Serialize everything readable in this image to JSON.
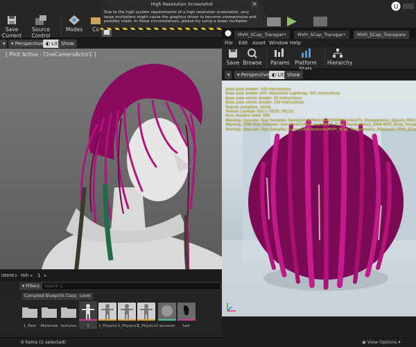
{
  "main_toolbar": {
    "save_current": "Save Current",
    "source_control": "Source Control",
    "modes": "Modes",
    "content_partial": "Co"
  },
  "screenshot_dialog": {
    "title": "High Resolution Screenshot",
    "message": "Due to the high system requirements of a high resolution screenshot, very large multipliers might cause the graphics driver to become unresponsive and possibly crash. In these circumstances, please try using a lower multiplier"
  },
  "left_viewport": {
    "perspective": "Perspective",
    "lit": "Lit",
    "show": "Show",
    "pilot_label": "[ Pilot Active - CineCameraActor1 ]"
  },
  "material_editor": {
    "tabs": [
      "MVH_SCap_Transpar•",
      "MVH_SCap_Transpar•",
      "MVH_SCap_Transpare"
    ],
    "menu": [
      "File",
      "Edit",
      "Asset",
      "Window",
      "Help"
    ],
    "toolbar": {
      "save": "Save",
      "browse": "Browse",
      "params": "Params",
      "platform_stats": "Platform Stats",
      "hierarchy": "Hierarchy"
    },
    "viewport": {
      "perspective": "Perspective",
      "lit": "Lit",
      "show": "Show"
    },
    "stats": [
      "Base pass shader: 329 instructions",
      "Base pass shader with Volumetric Lightmap: 451 instructions",
      "Base pass vertex shader: 55 instructions",
      "Base pass vertex shader: 150 instructions",
      "Texture samplers: 10/16",
      "Texture Lookups (Est.): VS(3), PS(15)",
      "Num shaders used: 566",
      "Warning: Specular Map Samples: Game/mh/1/Materials/SHM/Materials/Tx_Transparency_Opacity MVH_SCap_Transp...",
      "Warning: ORM Map Samples: Game/mh/1/textures/1/MVH_SCap_Transparency_ORM MVH_SCap_Transparency...",
      "Warning: Specular Map Samples: Game/mh/1/textures/MVH_SCap_Transparency_HSpecular MVH_SCap_Transparency..."
    ]
  },
  "content_browser": {
    "path_partial": "ntent",
    "path_segments": [
      "mh",
      "1"
    ],
    "filters_label": "Filters",
    "search_placeholder": "Search 1",
    "filter_chips": [
      "Compiled Blueprint Class",
      "Level"
    ],
    "assets": [
      {
        "name": "1_flam",
        "kind": "folder"
      },
      {
        "name": "Materials",
        "kind": "folder"
      },
      {
        "name": "textures",
        "kind": "folder"
      },
      {
        "name": "1",
        "kind": "mannequin",
        "selected": true
      },
      {
        "name": "1_Physics",
        "kind": "mannequin"
      },
      {
        "name": "1_Physics1",
        "kind": "mannequin"
      },
      {
        "name": "1_Physics2",
        "kind": "mannequin"
      },
      {
        "name": "accesoir",
        "kind": "material"
      },
      {
        "name": "hair",
        "kind": "hair"
      }
    ],
    "status": "9 items (1 selected)",
    "view_options": "View Options"
  },
  "colors": {
    "hair": "#a0106e",
    "stats_text": "#f2e24a",
    "hazard_yellow": "#e0c020",
    "lit_active": "#d8d8d8"
  }
}
